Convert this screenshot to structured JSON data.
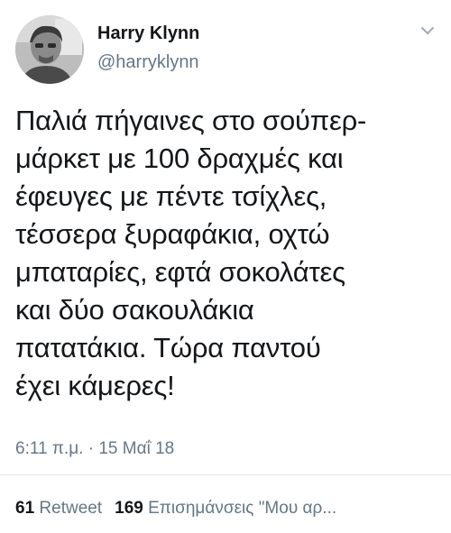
{
  "author": {
    "name": "Harry Klynn",
    "handle": "@harryklynn"
  },
  "tweet": {
    "lines": [
      "Παλιά πήγαινες στο σούπερ-",
      "μάρκετ με 100 δραχμές και",
      "έφευγες με πέντε τσίχλες,",
      "τέσσερα ξυραφάκια, οχτώ",
      "μπαταρίες, εφτά σοκολάτες",
      "και δύο σακουλάκια",
      "πατατάκια. Τώρα παντού",
      "έχει κάμερες!"
    ],
    "timestamp": "6:11 π.μ. · 15 Μαΐ 18"
  },
  "stats": {
    "retweets_count": "61",
    "retweets_label": "Retweet",
    "likes_count": "169",
    "likes_label": "Επισημάνσεις \"Μου αρ..."
  },
  "icons": {
    "caret": "chevron-down-icon"
  },
  "colors": {
    "text": "#14171a",
    "secondary": "#657786",
    "divider": "#e1e8ed"
  }
}
